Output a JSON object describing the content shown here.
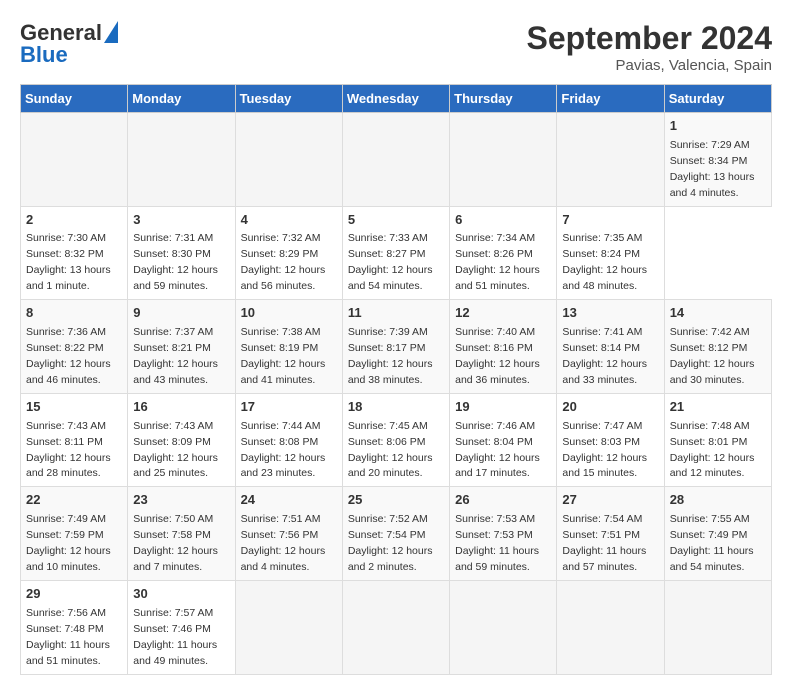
{
  "header": {
    "logo": {
      "general": "General",
      "blue": "Blue"
    },
    "title": "September 2024",
    "subtitle": "Pavias, Valencia, Spain"
  },
  "calendar": {
    "weekdays": [
      "Sunday",
      "Monday",
      "Tuesday",
      "Wednesday",
      "Thursday",
      "Friday",
      "Saturday"
    ],
    "weeks": [
      [
        null,
        null,
        null,
        null,
        null,
        null,
        {
          "day": "1",
          "sunrise": "Sunrise: 7:29 AM",
          "sunset": "Sunset: 8:34 PM",
          "daylight": "Daylight: 13 hours and 4 minutes."
        }
      ],
      [
        {
          "day": "2",
          "sunrise": "Sunrise: 7:30 AM",
          "sunset": "Sunset: 8:32 PM",
          "daylight": "Daylight: 13 hours and 1 minute."
        },
        {
          "day": "3",
          "sunrise": "Sunrise: 7:31 AM",
          "sunset": "Sunset: 8:30 PM",
          "daylight": "Daylight: 12 hours and 59 minutes."
        },
        {
          "day": "4",
          "sunrise": "Sunrise: 7:32 AM",
          "sunset": "Sunset: 8:29 PM",
          "daylight": "Daylight: 12 hours and 56 minutes."
        },
        {
          "day": "5",
          "sunrise": "Sunrise: 7:33 AM",
          "sunset": "Sunset: 8:27 PM",
          "daylight": "Daylight: 12 hours and 54 minutes."
        },
        {
          "day": "6",
          "sunrise": "Sunrise: 7:34 AM",
          "sunset": "Sunset: 8:26 PM",
          "daylight": "Daylight: 12 hours and 51 minutes."
        },
        {
          "day": "7",
          "sunrise": "Sunrise: 7:35 AM",
          "sunset": "Sunset: 8:24 PM",
          "daylight": "Daylight: 12 hours and 48 minutes."
        }
      ],
      [
        {
          "day": "8",
          "sunrise": "Sunrise: 7:36 AM",
          "sunset": "Sunset: 8:22 PM",
          "daylight": "Daylight: 12 hours and 46 minutes."
        },
        {
          "day": "9",
          "sunrise": "Sunrise: 7:37 AM",
          "sunset": "Sunset: 8:21 PM",
          "daylight": "Daylight: 12 hours and 43 minutes."
        },
        {
          "day": "10",
          "sunrise": "Sunrise: 7:38 AM",
          "sunset": "Sunset: 8:19 PM",
          "daylight": "Daylight: 12 hours and 41 minutes."
        },
        {
          "day": "11",
          "sunrise": "Sunrise: 7:39 AM",
          "sunset": "Sunset: 8:17 PM",
          "daylight": "Daylight: 12 hours and 38 minutes."
        },
        {
          "day": "12",
          "sunrise": "Sunrise: 7:40 AM",
          "sunset": "Sunset: 8:16 PM",
          "daylight": "Daylight: 12 hours and 36 minutes."
        },
        {
          "day": "13",
          "sunrise": "Sunrise: 7:41 AM",
          "sunset": "Sunset: 8:14 PM",
          "daylight": "Daylight: 12 hours and 33 minutes."
        },
        {
          "day": "14",
          "sunrise": "Sunrise: 7:42 AM",
          "sunset": "Sunset: 8:12 PM",
          "daylight": "Daylight: 12 hours and 30 minutes."
        }
      ],
      [
        {
          "day": "15",
          "sunrise": "Sunrise: 7:43 AM",
          "sunset": "Sunset: 8:11 PM",
          "daylight": "Daylight: 12 hours and 28 minutes."
        },
        {
          "day": "16",
          "sunrise": "Sunrise: 7:43 AM",
          "sunset": "Sunset: 8:09 PM",
          "daylight": "Daylight: 12 hours and 25 minutes."
        },
        {
          "day": "17",
          "sunrise": "Sunrise: 7:44 AM",
          "sunset": "Sunset: 8:08 PM",
          "daylight": "Daylight: 12 hours and 23 minutes."
        },
        {
          "day": "18",
          "sunrise": "Sunrise: 7:45 AM",
          "sunset": "Sunset: 8:06 PM",
          "daylight": "Daylight: 12 hours and 20 minutes."
        },
        {
          "day": "19",
          "sunrise": "Sunrise: 7:46 AM",
          "sunset": "Sunset: 8:04 PM",
          "daylight": "Daylight: 12 hours and 17 minutes."
        },
        {
          "day": "20",
          "sunrise": "Sunrise: 7:47 AM",
          "sunset": "Sunset: 8:03 PM",
          "daylight": "Daylight: 12 hours and 15 minutes."
        },
        {
          "day": "21",
          "sunrise": "Sunrise: 7:48 AM",
          "sunset": "Sunset: 8:01 PM",
          "daylight": "Daylight: 12 hours and 12 minutes."
        }
      ],
      [
        {
          "day": "22",
          "sunrise": "Sunrise: 7:49 AM",
          "sunset": "Sunset: 7:59 PM",
          "daylight": "Daylight: 12 hours and 10 minutes."
        },
        {
          "day": "23",
          "sunrise": "Sunrise: 7:50 AM",
          "sunset": "Sunset: 7:58 PM",
          "daylight": "Daylight: 12 hours and 7 minutes."
        },
        {
          "day": "24",
          "sunrise": "Sunrise: 7:51 AM",
          "sunset": "Sunset: 7:56 PM",
          "daylight": "Daylight: 12 hours and 4 minutes."
        },
        {
          "day": "25",
          "sunrise": "Sunrise: 7:52 AM",
          "sunset": "Sunset: 7:54 PM",
          "daylight": "Daylight: 12 hours and 2 minutes."
        },
        {
          "day": "26",
          "sunrise": "Sunrise: 7:53 AM",
          "sunset": "Sunset: 7:53 PM",
          "daylight": "Daylight: 11 hours and 59 minutes."
        },
        {
          "day": "27",
          "sunrise": "Sunrise: 7:54 AM",
          "sunset": "Sunset: 7:51 PM",
          "daylight": "Daylight: 11 hours and 57 minutes."
        },
        {
          "day": "28",
          "sunrise": "Sunrise: 7:55 AM",
          "sunset": "Sunset: 7:49 PM",
          "daylight": "Daylight: 11 hours and 54 minutes."
        }
      ],
      [
        {
          "day": "29",
          "sunrise": "Sunrise: 7:56 AM",
          "sunset": "Sunset: 7:48 PM",
          "daylight": "Daylight: 11 hours and 51 minutes."
        },
        {
          "day": "30",
          "sunrise": "Sunrise: 7:57 AM",
          "sunset": "Sunset: 7:46 PM",
          "daylight": "Daylight: 11 hours and 49 minutes."
        },
        null,
        null,
        null,
        null,
        null
      ]
    ]
  }
}
